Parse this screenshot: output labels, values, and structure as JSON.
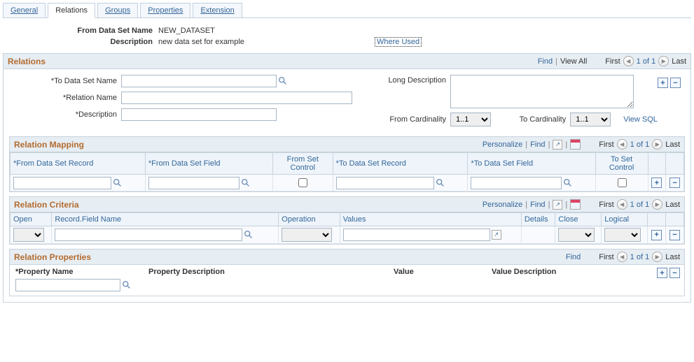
{
  "tabs": {
    "general": "General",
    "relations": "Relations",
    "groups": "Groups",
    "properties": "Properties",
    "extension": "Extension"
  },
  "header": {
    "from_ds_label": "From Data Set Name",
    "from_ds_value": "NEW_DATASET",
    "description_label": "Description",
    "description_value": "new data set for example",
    "where_used": "Where Used"
  },
  "relations_section": {
    "title": "Relations",
    "find": "Find",
    "view_all": "View All",
    "first": "First",
    "count": "1 of 1",
    "last": "Last",
    "to_ds_label": "*To Data Set Name",
    "relation_name_label": "*Relation Name",
    "description_label": "*Description",
    "long_desc_label": "Long Description",
    "from_card_label": "From Cardinality",
    "to_card_label": "To Cardinality",
    "from_card_value": "1..1",
    "to_card_value": "1..1",
    "view_sql": "View SQL"
  },
  "mapping": {
    "title": "Relation Mapping",
    "personalize": "Personalize",
    "find": "Find",
    "first": "First",
    "count": "1 of 1",
    "last": "Last",
    "cols": {
      "from_rec": "*From Data Set Record",
      "from_fld": "*From Data Set Field",
      "from_ctrl": "From Set Control",
      "to_rec": "*To Data Set Record",
      "to_fld": "*To Data Set Field",
      "to_ctrl": "To Set Control"
    }
  },
  "criteria": {
    "title": "Relation Criteria",
    "personalize": "Personalize",
    "find": "Find",
    "first": "First",
    "count": "1 of 1",
    "last": "Last",
    "cols": {
      "open": "Open",
      "record_field": "Record.Field Name",
      "operation": "Operation",
      "values": "Values",
      "details": "Details",
      "close": "Close",
      "logical": "Logical"
    }
  },
  "properties": {
    "title": "Relation Properties",
    "find": "Find",
    "first": "First",
    "count": "1 of 1",
    "last": "Last",
    "cols": {
      "prop_name": "*Property Name",
      "prop_desc": "Property Description",
      "value": "Value",
      "value_desc": "Value Description"
    }
  }
}
